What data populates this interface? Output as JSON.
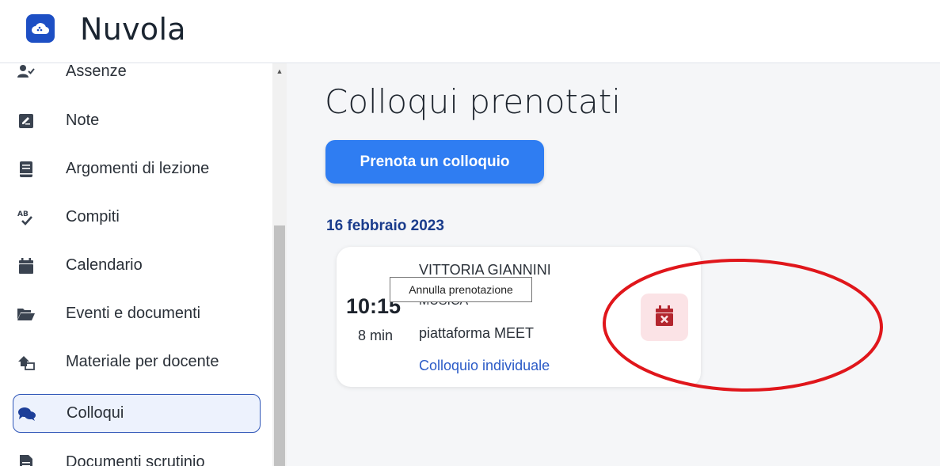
{
  "header": {
    "app_title": "Nuvola",
    "logo_icon": "cloud-icon",
    "logo_color": "#1d4fc4"
  },
  "sidebar": {
    "items": [
      {
        "label": "Assenze",
        "icon": "user-check-icon",
        "active": false
      },
      {
        "label": "Note",
        "icon": "note-pen-icon",
        "active": false
      },
      {
        "label": "Argomenti di lezione",
        "icon": "book-icon",
        "active": false
      },
      {
        "label": "Compiti",
        "icon": "spellcheck-icon",
        "active": false
      },
      {
        "label": "Calendario",
        "icon": "calendar-icon",
        "active": false
      },
      {
        "label": "Eventi e documenti",
        "icon": "folder-open-icon",
        "active": false
      },
      {
        "label": "Materiale per docente",
        "icon": "upload-home-icon",
        "active": false
      },
      {
        "label": "Colloqui",
        "icon": "chat-bubbles-icon",
        "active": true
      },
      {
        "label": "Documenti scrutinio",
        "icon": "document-icon",
        "active": false
      }
    ],
    "active_color": "#2f56b8"
  },
  "main": {
    "page_title": "Colloqui prenotati",
    "book_button_label": "Prenota un colloquio",
    "accent_color": "#2f7df2",
    "groups": [
      {
        "date": "16 febbraio 2023",
        "meetings": [
          {
            "time": "10:15",
            "duration": "8 min",
            "teacher": "VITTORIA GIANNINI",
            "subject": "MUSICA",
            "platform": "piattaforma MEET",
            "type": "Colloquio individuale",
            "cancel_icon": "calendar-x-icon"
          }
        ]
      }
    ]
  },
  "tooltip": {
    "text": "Annulla prenotazione"
  },
  "annotation": {
    "shape": "red-ellipse",
    "color": "#e0161b"
  }
}
